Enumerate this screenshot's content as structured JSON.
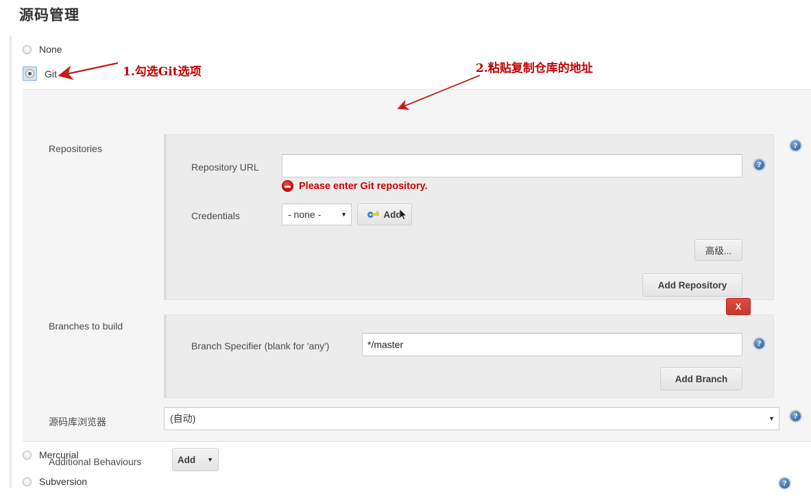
{
  "page": {
    "title": "源码管理"
  },
  "scm_options": [
    {
      "label": "None",
      "selected": false
    },
    {
      "label": "Git",
      "selected": true
    },
    {
      "label": "Mercurial",
      "selected": false
    },
    {
      "label": "Subversion",
      "selected": false
    }
  ],
  "git": {
    "repositories": {
      "section_label": "Repositories",
      "repository_url_label": "Repository URL",
      "repository_url_value": "",
      "error_message": "Please enter Git repository.",
      "credentials_label": "Credentials",
      "credentials_value": "- none -",
      "credentials_add_label": "Add",
      "advanced_label": "高级...",
      "add_repository_label": "Add Repository",
      "delete_label": "X"
    },
    "branches": {
      "section_label": "Branches to build",
      "branch_specifier_label": "Branch Specifier (blank for 'any')",
      "branch_specifier_value": "*/master",
      "add_branch_label": "Add Branch",
      "delete_label": "X"
    },
    "repository_browser": {
      "label": "源码库浏览器",
      "value": "(自动)"
    },
    "additional_behaviours": {
      "label": "Additional Behaviours",
      "add_label": "Add"
    }
  },
  "icons": {
    "help": "?",
    "caret_down": "▼",
    "caret_small": "▼"
  },
  "annotations": [
    {
      "text": "1.勾选Git选项"
    },
    {
      "text": "2.粘贴复制仓库的地址"
    }
  ],
  "colors": {
    "accent_red": "#c00000",
    "error_red": "#cc0000",
    "help_blue": "#3f6ea8",
    "panel_bg": "#f5f5f5",
    "inner_bg": "#ececec"
  }
}
